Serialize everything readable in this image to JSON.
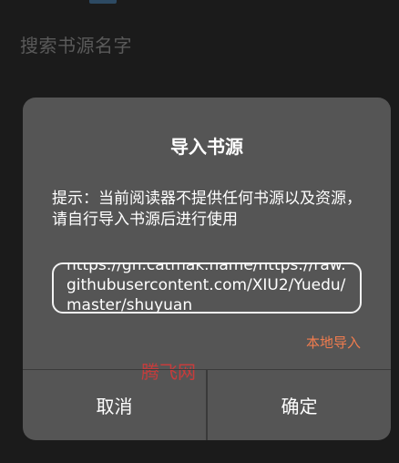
{
  "background": {
    "search_placeholder": "搜索书源名字"
  },
  "dialog": {
    "title": "导入书源",
    "message": "提示：当前阅读器不提供任何书源以及资源，请自行导入书源后进行使用",
    "url_value": "https://gh.catmak.name/https://raw.githubusercontent.com/XIU2/Yuedu/master/shuyuan",
    "local_import_label": "本地导入",
    "cancel_label": "取消",
    "confirm_label": "确定",
    "watermark_text": "腾飞网"
  },
  "colors": {
    "dialog_bg": "#555555",
    "accent": "#f07c4e",
    "watermark": "#d43a3a"
  }
}
